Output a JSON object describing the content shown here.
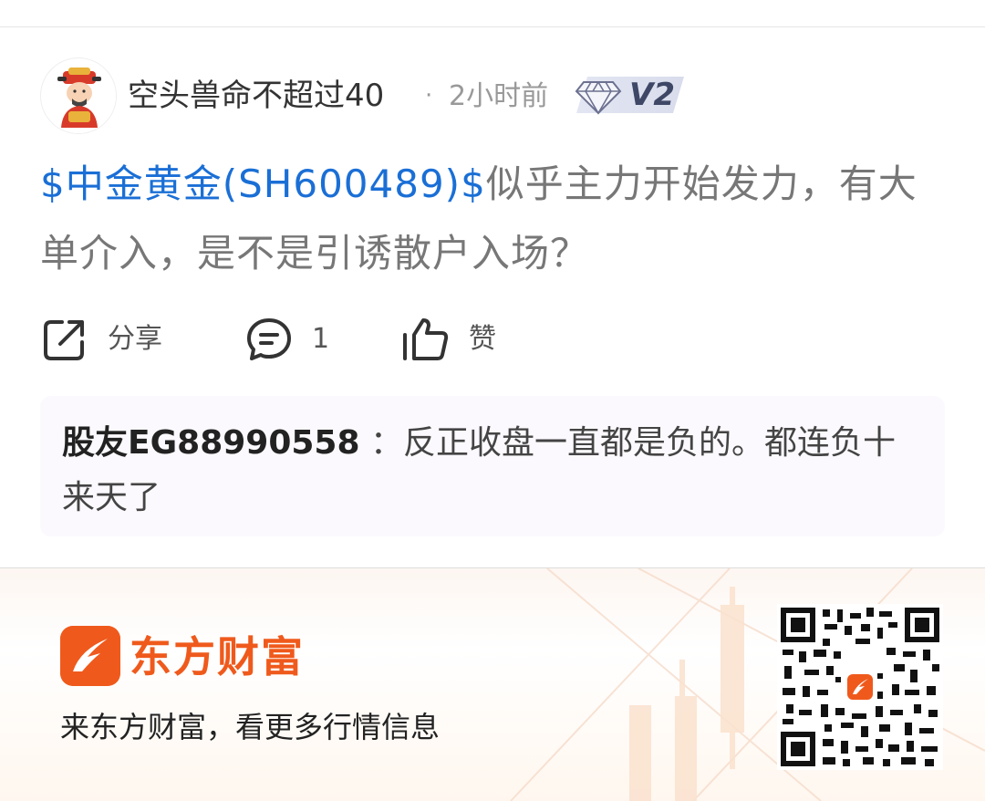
{
  "post": {
    "username": "空头兽命不超过40",
    "separator": "·",
    "time": "2小时前",
    "level": "V2",
    "stock_link": "$中金黄金(SH600489)$",
    "content_text": "似乎主力开始发力，有大单介入，是不是引诱散户入场？"
  },
  "actions": {
    "share_label": "分享",
    "comment_count": "1",
    "like_label": "赞"
  },
  "comment": {
    "user": "股友EG88990558",
    "separator": "：",
    "text": "反正收盘一直都是负的。都连负十来天了"
  },
  "footer": {
    "brand_name": "东方财富",
    "slogan": "来东方财富，看更多行情信息"
  },
  "colors": {
    "link_blue": "#1a6fd6",
    "brand_orange": "#ef5a1c",
    "text_gray": "#777777"
  },
  "icons": [
    "avatar-god-of-wealth",
    "diamond-icon",
    "share-icon",
    "comment-icon",
    "thumbs-up-icon",
    "brand-logo-icon",
    "qr-code"
  ]
}
